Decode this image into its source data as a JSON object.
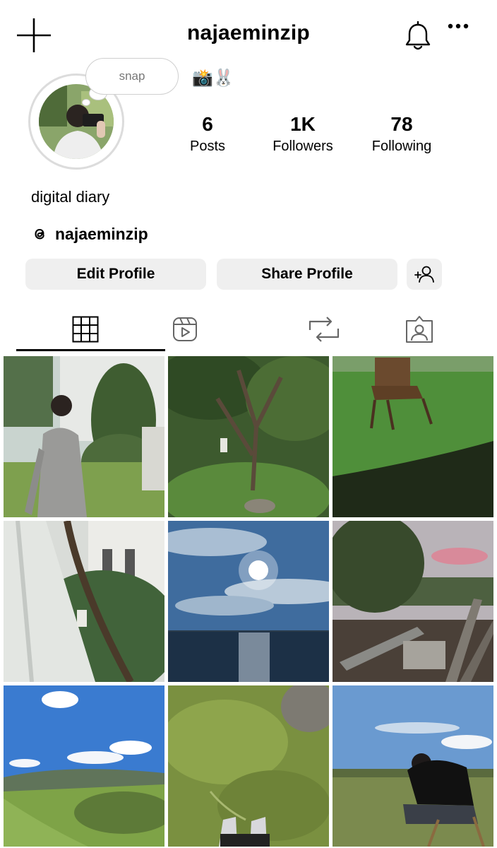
{
  "header": {
    "username": "najaeminzip",
    "icons": {
      "create": "plus-icon",
      "notifications": "bell-icon",
      "more": "more-horizontal-icon"
    }
  },
  "profile": {
    "note": "snap",
    "emojis": "📸🐰",
    "stats": [
      {
        "value": "6",
        "label": "Posts"
      },
      {
        "value": "1K",
        "label": "Followers"
      },
      {
        "value": "78",
        "label": "Following"
      }
    ],
    "bio": "digital diary",
    "threads_handle": "najaeminzip"
  },
  "actions": {
    "edit_label": "Edit Profile",
    "share_label": "Share Profile",
    "add_icon": "add-person-icon"
  },
  "tabs": [
    {
      "icon": "grid-icon",
      "active": true
    },
    {
      "icon": "reels-icon",
      "active": false
    },
    {
      "icon": "repost-icon",
      "active": false
    },
    {
      "icon": "tagged-icon",
      "active": false
    }
  ],
  "posts": [
    {
      "subject": "man in grey blazer in garden"
    },
    {
      "subject": "garden tree with lantern"
    },
    {
      "subject": "wooden chair on lawn"
    },
    {
      "subject": "curtain and tree by building"
    },
    {
      "subject": "sun over sea"
    },
    {
      "subject": "trees and stacked wood at dusk"
    },
    {
      "subject": "green hills under blue sky"
    },
    {
      "subject": "feet in white sneakers on grass"
    },
    {
      "subject": "person seated in field"
    }
  ]
}
